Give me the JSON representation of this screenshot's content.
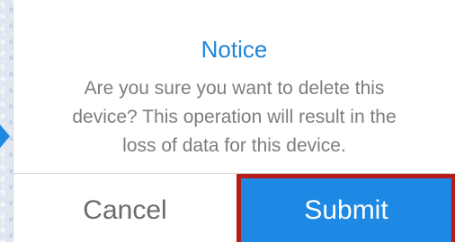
{
  "dialog": {
    "title": "Notice",
    "message_lines": [
      "Are you sure you want to delete this",
      "device? This operation will result in the",
      "loss of data for this device."
    ],
    "cancel_label": "Cancel",
    "submit_label": "Submit"
  },
  "colors": {
    "accent": "#1e88e5",
    "highlight_border": "#b71c1c",
    "title": "#1f86d8",
    "message_text": "#7d7d7d"
  }
}
